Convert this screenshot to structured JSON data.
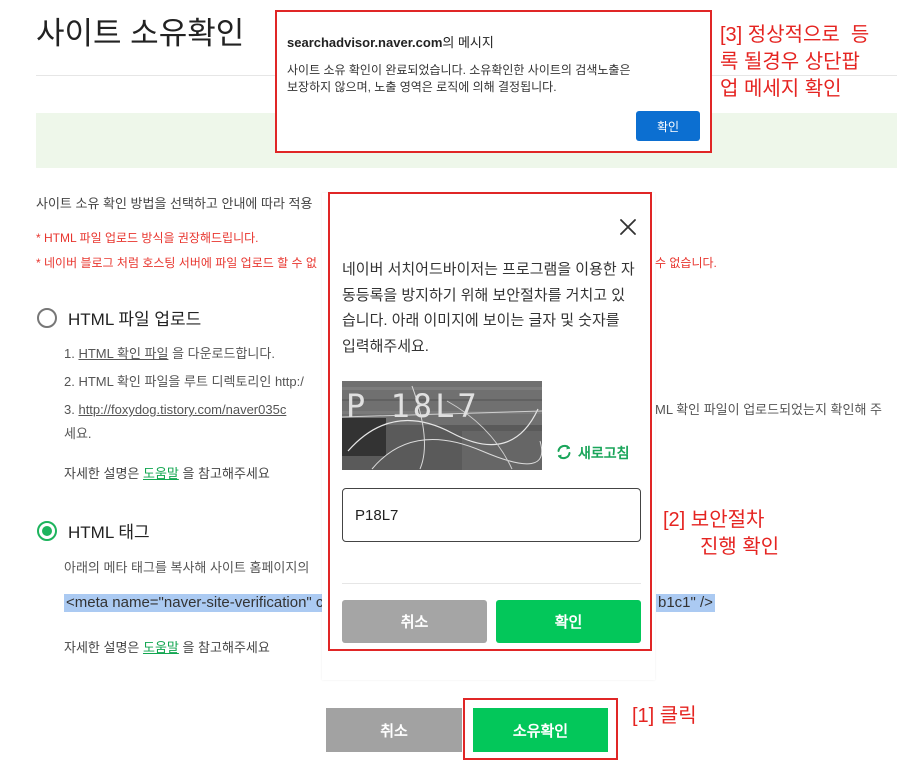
{
  "page": {
    "title": "사이트 소유확인",
    "intro": "사이트 소유 확인 방법을 선택하고 안내에 따라 적용",
    "notes": {
      "recommend": "* HTML 파일 업로드 방식을 권장해드립니다.",
      "blog_left": "* 네이버 블로그 처럼 호스팅 서버에 파일 업로드 할 수 없",
      "blog_right": "수 없습니다."
    },
    "methods": {
      "html_file": {
        "label": "HTML 파일 업로드",
        "selected": false,
        "step1": {
          "prefix": "1. ",
          "link": "HTML 확인 파일",
          "suffix": " 을 다운로드합니다."
        },
        "step2": "2. HTML 확인 파일을 루트 디렉토리인 http:/",
        "step3": {
          "prefix": "3. ",
          "link": "http://foxydog.tistory.com/naver035c",
          "right": "ML 확인 파일이 업로드되었는지 확인해 주",
          "wrap": "세요."
        },
        "help": {
          "prefix": "자세한 설명은 ",
          "link": "도움말",
          "suffix": " 을 참고해주세요"
        }
      },
      "html_tag": {
        "label": "HTML 태그",
        "selected": true,
        "desc": "아래의 메타 태그를 복사해 사이트 홈페이지의",
        "meta_left": "<meta name=\"naver-site-verification\" co",
        "meta_right": "b1c1\" />",
        "help": {
          "prefix": "자세한 설명은 ",
          "link": "도움말",
          "suffix": " 을 참고해주세요"
        }
      }
    },
    "footer": {
      "cancel": "취소",
      "confirm": "소유확인"
    }
  },
  "alert": {
    "host": "searchadvisor.naver.com",
    "title_suffix": "의 메시지",
    "message_lines": [
      "사이트 소유 확인이 완료되었습니다. 소유확인한 사이트의 검색노출은",
      "보장하지 않으며, 노출 영역은 로직에 의해 결정됩니다."
    ],
    "ok": "확인"
  },
  "captcha_modal": {
    "close_icon": "close-icon",
    "instructions": [
      "네이버 서치어드바이저는 프로그램을 이용한 자",
      "동등록을 방지하기 위해 보안절차를 거치고 있",
      "습니다. 아래 이미지에 보이는 글자 및 숫자를",
      "입력해주세요."
    ],
    "image_text": "P 18L7",
    "refresh_icon": "refresh-icon",
    "refresh": "새로고침",
    "input_value": "P18L7",
    "cancel": "취소",
    "confirm": "확인"
  },
  "annotations": {
    "step1": "[1] 클릭",
    "step2": [
      "[2] 보안절차",
      "진행 확인"
    ],
    "step3": [
      "[3] 정상적으로  등",
      "록 될경우 상단팝",
      "업 메세지 확인"
    ]
  },
  "colors": {
    "brand_green": "#03c75a",
    "link_green": "#12a650",
    "annotation_red": "#e52421",
    "notice_red": "#e8352e",
    "alert_button_blue": "#0c6fd1",
    "banner_green": "#eef7ea"
  }
}
